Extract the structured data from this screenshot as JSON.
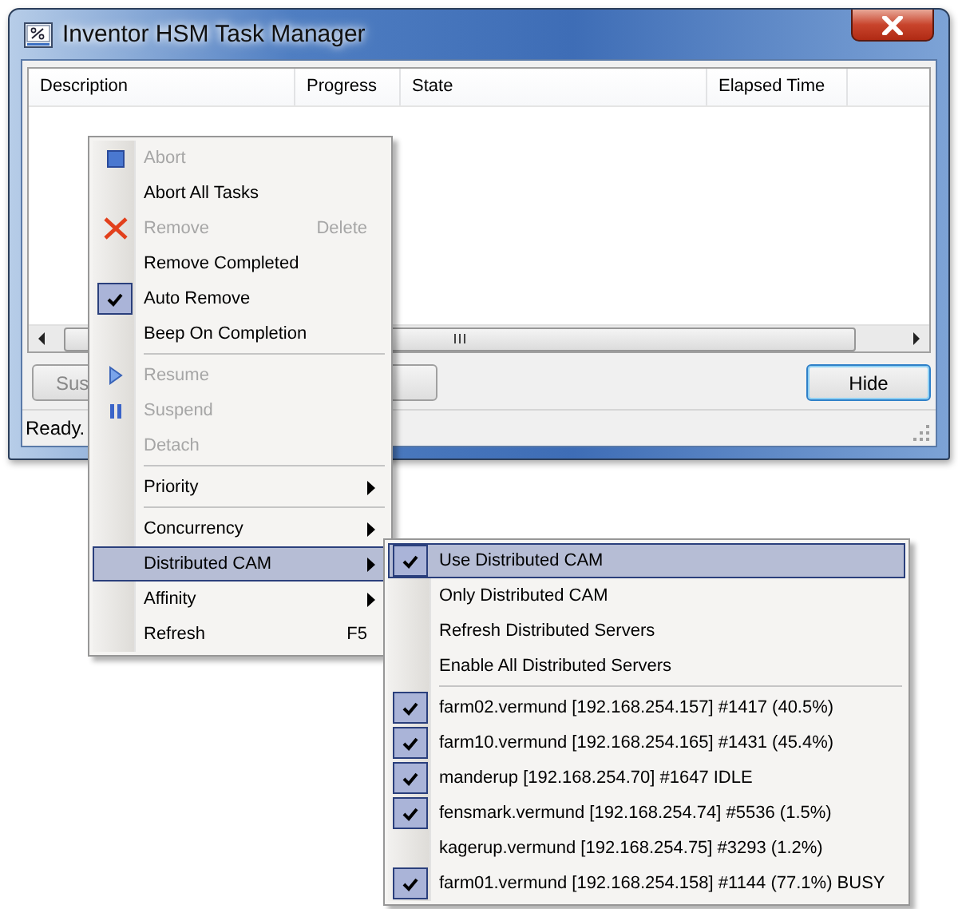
{
  "window": {
    "title": "Inventor HSM Task Manager"
  },
  "table": {
    "columns": [
      "Description",
      "Progress",
      "State",
      "Elapsed Time"
    ]
  },
  "buttons": [
    {
      "label": "Sus",
      "default": false
    },
    {
      "label": "Hide",
      "default": true
    }
  ],
  "status_bar": "Ready.",
  "context_menu": [
    {
      "kind": "stop",
      "label": "Abort",
      "disabled": true,
      "checked": false,
      "selected": false,
      "submenu": false
    },
    {
      "kind": "item",
      "label": "Abort All Tasks",
      "disabled": false,
      "checked": false,
      "selected": false,
      "submenu": false
    },
    {
      "kind": "delete",
      "label": "Remove",
      "shortcut": "Delete",
      "disabled": true,
      "checked": false,
      "selected": false,
      "submenu": false
    },
    {
      "kind": "item",
      "label": "Remove Completed",
      "disabled": false,
      "checked": false,
      "selected": false,
      "submenu": false
    },
    {
      "kind": "item",
      "label": "Auto Remove",
      "disabled": false,
      "checked": true,
      "selected": false,
      "submenu": false
    },
    {
      "kind": "item",
      "label": "Beep On Completion",
      "disabled": false,
      "checked": false,
      "selected": false,
      "submenu": false
    },
    {
      "kind": "separator"
    },
    {
      "kind": "play",
      "label": "Resume",
      "disabled": true,
      "checked": false,
      "selected": false,
      "submenu": false
    },
    {
      "kind": "pause",
      "label": "Suspend",
      "disabled": true,
      "checked": false,
      "selected": false,
      "submenu": false
    },
    {
      "kind": "item",
      "label": "Detach",
      "disabled": true,
      "checked": false,
      "selected": false,
      "submenu": false
    },
    {
      "kind": "separator"
    },
    {
      "kind": "item",
      "label": "Priority",
      "disabled": false,
      "checked": false,
      "selected": false,
      "submenu": true
    },
    {
      "kind": "separator"
    },
    {
      "kind": "item",
      "label": "Concurrency",
      "disabled": false,
      "checked": false,
      "selected": false,
      "submenu": true
    },
    {
      "kind": "item",
      "label": "Distributed CAM",
      "disabled": false,
      "checked": false,
      "selected": true,
      "submenu": true
    },
    {
      "kind": "item",
      "label": "Affinity",
      "disabled": false,
      "checked": false,
      "selected": false,
      "submenu": true
    },
    {
      "kind": "item",
      "label": "Refresh",
      "shortcut": "F5",
      "disabled": false,
      "checked": false,
      "selected": false,
      "submenu": false
    }
  ],
  "submenu": [
    {
      "kind": "item",
      "label": "Use Distributed CAM",
      "checked": true,
      "selected": true
    },
    {
      "kind": "item",
      "label": "Only Distributed CAM",
      "checked": false,
      "selected": false
    },
    {
      "kind": "item",
      "label": "Refresh Distributed Servers",
      "checked": false,
      "selected": false
    },
    {
      "kind": "item",
      "label": "Enable All Distributed Servers",
      "checked": false,
      "selected": false
    },
    {
      "kind": "separator"
    },
    {
      "kind": "item",
      "label": "farm02.vermund [192.168.254.157] #1417 (40.5%)",
      "checked": true,
      "selected": false
    },
    {
      "kind": "item",
      "label": "farm10.vermund [192.168.254.165] #1431 (45.4%)",
      "checked": true,
      "selected": false
    },
    {
      "kind": "item",
      "label": "manderup [192.168.254.70] #1647 IDLE",
      "checked": true,
      "selected": false
    },
    {
      "kind": "item",
      "label": "fensmark.vermund [192.168.254.74] #5536 (1.5%)",
      "checked": true,
      "selected": false
    },
    {
      "kind": "item",
      "label": "kagerup.vermund [192.168.254.75] #3293 (1.2%)",
      "checked": false,
      "selected": false
    },
    {
      "kind": "item",
      "label": "farm01.vermund [192.168.254.158] #1144 (77.1%) BUSY",
      "checked": true,
      "selected": false
    }
  ]
}
